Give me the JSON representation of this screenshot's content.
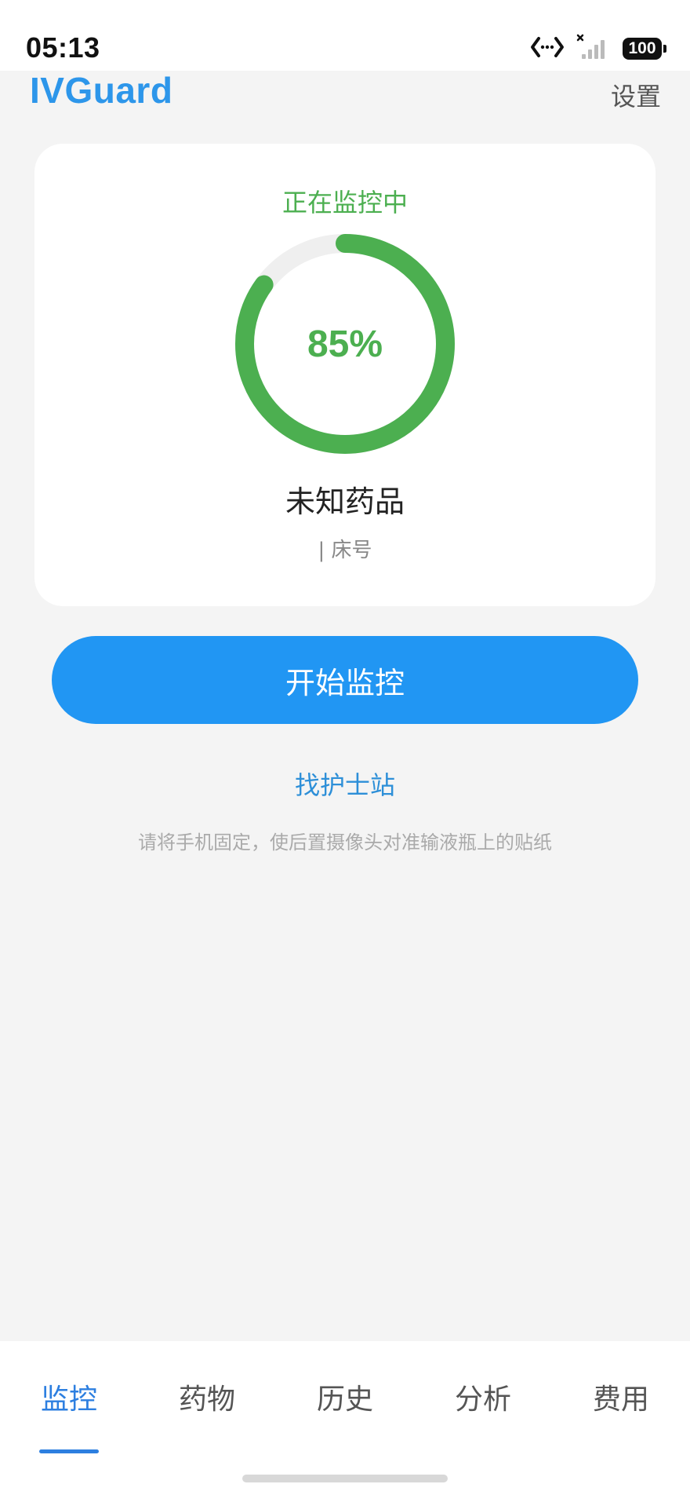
{
  "status_bar": {
    "time": "05:13",
    "battery": "100",
    "icons": [
      "data-transfer-icon",
      "no-signal-icon",
      "battery-icon"
    ]
  },
  "header": {
    "brand": "IVGuard",
    "settings_label": "设置"
  },
  "monitor": {
    "status_text": "正在监控中",
    "progress_percent": 85,
    "progress_label": "85%",
    "drug_name": "未知药品",
    "bed_label": "| 床号",
    "ring_color": "#4caf50",
    "ring_track_color": "#efefef"
  },
  "actions": {
    "start_label": "开始监控",
    "nurse_station_label": "找护士站",
    "hint": "请将手机固定，使后置摄像头对准输液瓶上的贴纸"
  },
  "bottom_nav": {
    "items": [
      {
        "label": "监控",
        "active": true
      },
      {
        "label": "药物",
        "active": false
      },
      {
        "label": "历史",
        "active": false
      },
      {
        "label": "分析",
        "active": false
      },
      {
        "label": "费用",
        "active": false
      }
    ]
  },
  "colors": {
    "accent": "#2196f3",
    "brand": "#2d96ea",
    "success": "#4caf50"
  }
}
